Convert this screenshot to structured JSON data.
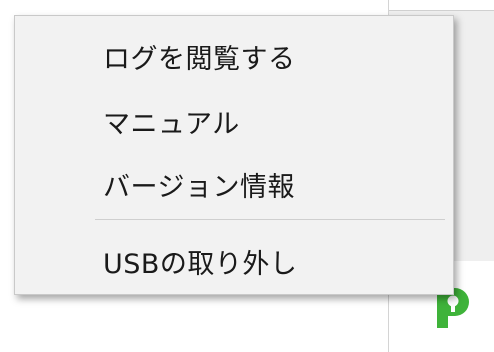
{
  "context_menu": {
    "items": [
      {
        "label": "ログを閲覧する"
      },
      {
        "label": "マニュアル"
      },
      {
        "label": "バージョン情報"
      },
      {
        "label": "USBの取り外し"
      }
    ]
  },
  "icons": {
    "app_icon": "green-p-app-icon",
    "accent_color": "#3fb33a"
  }
}
